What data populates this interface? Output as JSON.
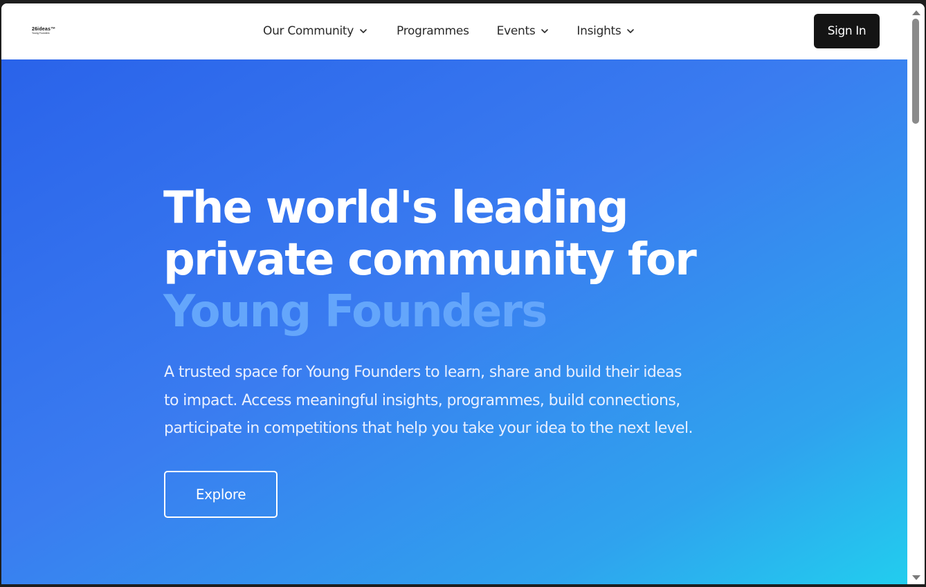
{
  "logo": {
    "main": "26ideas™",
    "sub": "Young Founders"
  },
  "nav": {
    "items": [
      {
        "label": "Our Community",
        "has_dropdown": true,
        "icon": "chevron-down-icon"
      },
      {
        "label": "Programmes",
        "has_dropdown": false
      },
      {
        "label": "Events",
        "has_dropdown": true,
        "icon": "chevron-down-icon"
      },
      {
        "label": "Insights",
        "has_dropdown": true,
        "icon": "chevron-down-icon"
      }
    ],
    "signin_label": "Sign In"
  },
  "hero": {
    "title_lines": [
      "The world's leading",
      "private community for"
    ],
    "title_accent": "Young Founders",
    "description_lines": [
      "A trusted space for Young Founders to learn, share and build their ideas",
      "to impact. Access meaningful insights, programmes, build connections,",
      "participate in competitions that help you take your idea to the next level."
    ],
    "cta_label": "Explore"
  },
  "colors": {
    "header_bg": "#ffffff",
    "signin_bg": "#141414",
    "hero_gradient_start": "#2a63ea",
    "hero_gradient_end": "#22cdee",
    "title_accent": "#64a6fb"
  }
}
